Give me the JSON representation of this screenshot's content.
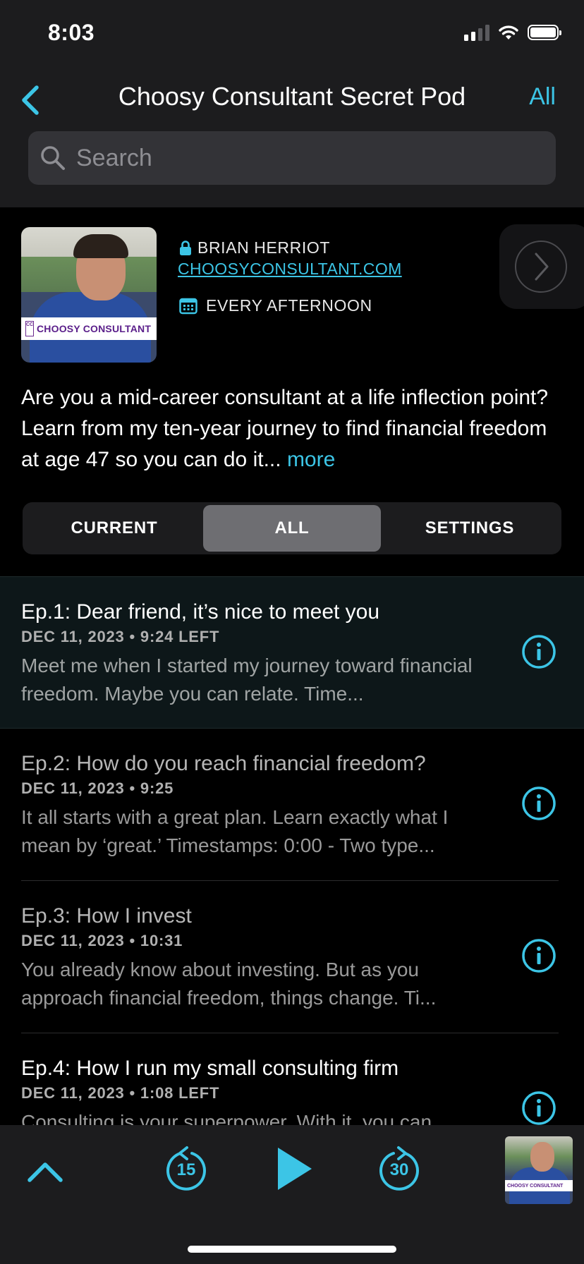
{
  "status_bar": {
    "time": "8:03"
  },
  "nav": {
    "title": "Choosy Consultant Secret Pod",
    "right_label": "All"
  },
  "search": {
    "placeholder": "Search"
  },
  "podcast": {
    "artwork_brand": "CHOOSY CONSULTANT",
    "artwork_cc": "CC",
    "author": "BRIAN HERRIOT",
    "website": "CHOOSYCONSULTANT.COM",
    "schedule": "EVERY AFTERNOON",
    "description": "Are you a mid-career consultant at a life inflection point? Learn from my ten-year journey to find financial freedom at age 47 so you can do it...",
    "more_label": "more"
  },
  "tabs": [
    {
      "label": "CURRENT",
      "active": false
    },
    {
      "label": "ALL",
      "active": true
    },
    {
      "label": "SETTINGS",
      "active": false
    }
  ],
  "episodes": [
    {
      "title": "Ep.1: Dear friend, it’s nice to meet you",
      "date": "DEC 11, 2023",
      "duration": "9:24 LEFT",
      "description": "Meet me when I started my journey toward financial freedom. Maybe you can relate. Time...",
      "state": "current"
    },
    {
      "title": "Ep.2: How do you reach financial freedom?",
      "date": "DEC 11, 2023",
      "duration": "9:25",
      "description": "It all starts with a great plan. Learn exactly what I mean by ‘great.’ Timestamps: 0:00 - Two type...",
      "state": "played"
    },
    {
      "title": "Ep.3: How I invest",
      "date": "DEC 11, 2023",
      "duration": "10:31",
      "description": "You already know about investing. But as you approach financial freedom, things change. Ti...",
      "state": "played"
    },
    {
      "title": "Ep.4: How I run my small consulting firm",
      "date": "DEC 11, 2023",
      "duration": "1:08 LEFT",
      "description": "Consulting is your superpower. With it, you can...",
      "state": "unplayed"
    }
  ],
  "player": {
    "skip_back_label": "15",
    "skip_forward_label": "30",
    "thumb_brand": "CHOOSY CONSULTANT"
  },
  "colors": {
    "accent": "#3cc5e6",
    "background": "#000000",
    "panel": "#1c1c1e"
  }
}
